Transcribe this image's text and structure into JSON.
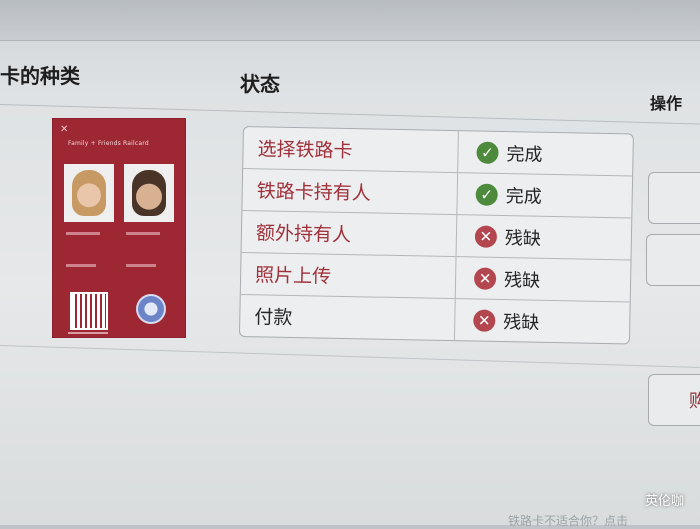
{
  "columns": {
    "card": "卡的种类",
    "status": "状态",
    "action": "操作"
  },
  "railcard": {
    "title": "Family + Friends Railcard"
  },
  "steps": [
    {
      "label": "选择铁路卡",
      "status": "完成",
      "ok": true
    },
    {
      "label": "铁路卡持有人",
      "status": "完成",
      "ok": true
    },
    {
      "label": "额外持有人",
      "status": "残缺",
      "ok": false
    },
    {
      "label": "照片上传",
      "status": "残缺",
      "ok": false
    },
    {
      "label": "付款",
      "status": "残缺",
      "ok": false
    }
  ],
  "buttons": {
    "third_label_partial": "购"
  },
  "hint_partial": "铁路卡不适合你？点击",
  "watermark": "英伦咖",
  "colors": {
    "brand_red": "#9d2733",
    "ok_green": "#4d8a3c",
    "error_red": "#b3464f"
  },
  "icons": {
    "ok": "check-circle-icon",
    "bad": "x-circle-icon"
  }
}
